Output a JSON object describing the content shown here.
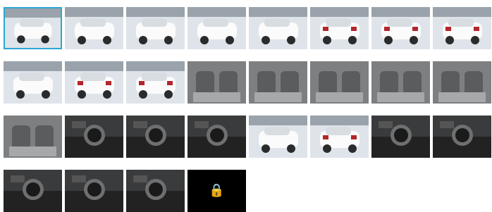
{
  "gallery": {
    "selected_index": 0,
    "photos": [
      {
        "icon": "car-front-three-quarter-left-photo"
      },
      {
        "icon": "car-front-three-quarter-right-photo"
      },
      {
        "icon": "car-front-photo"
      },
      {
        "icon": "car-front-photo"
      },
      {
        "icon": "car-side-photo"
      },
      {
        "icon": "car-rear-photo"
      },
      {
        "icon": "car-rear-photo"
      },
      {
        "icon": "car-taillight-closeup-photo"
      },
      {
        "icon": "car-headlight-closeup-photo"
      },
      {
        "icon": "car-rear-three-quarter-photo"
      },
      {
        "icon": "car-rear-three-quarter-photo"
      },
      {
        "icon": "front-seats-photo"
      },
      {
        "icon": "rear-seat-photo"
      },
      {
        "icon": "rear-seat-photo"
      },
      {
        "icon": "rear-seat-photo"
      },
      {
        "icon": "trunk-photo"
      },
      {
        "icon": "spare-wheel-photo"
      },
      {
        "icon": "dashboard-photo"
      },
      {
        "icon": "dashboard-passenger-side-photo"
      },
      {
        "icon": "gear-shifter-photo"
      },
      {
        "icon": "tailgate-badge-photo"
      },
      {
        "icon": "taillight-photo"
      },
      {
        "icon": "climate-controls-photo"
      },
      {
        "icon": "instrument-cluster-photo"
      },
      {
        "icon": "door-controls-photo"
      },
      {
        "icon": "steering-wheel-photo"
      },
      {
        "icon": "steering-column-photo"
      }
    ],
    "locked_tile": {
      "icon": "lock-icon",
      "glyph": "🔒"
    }
  }
}
